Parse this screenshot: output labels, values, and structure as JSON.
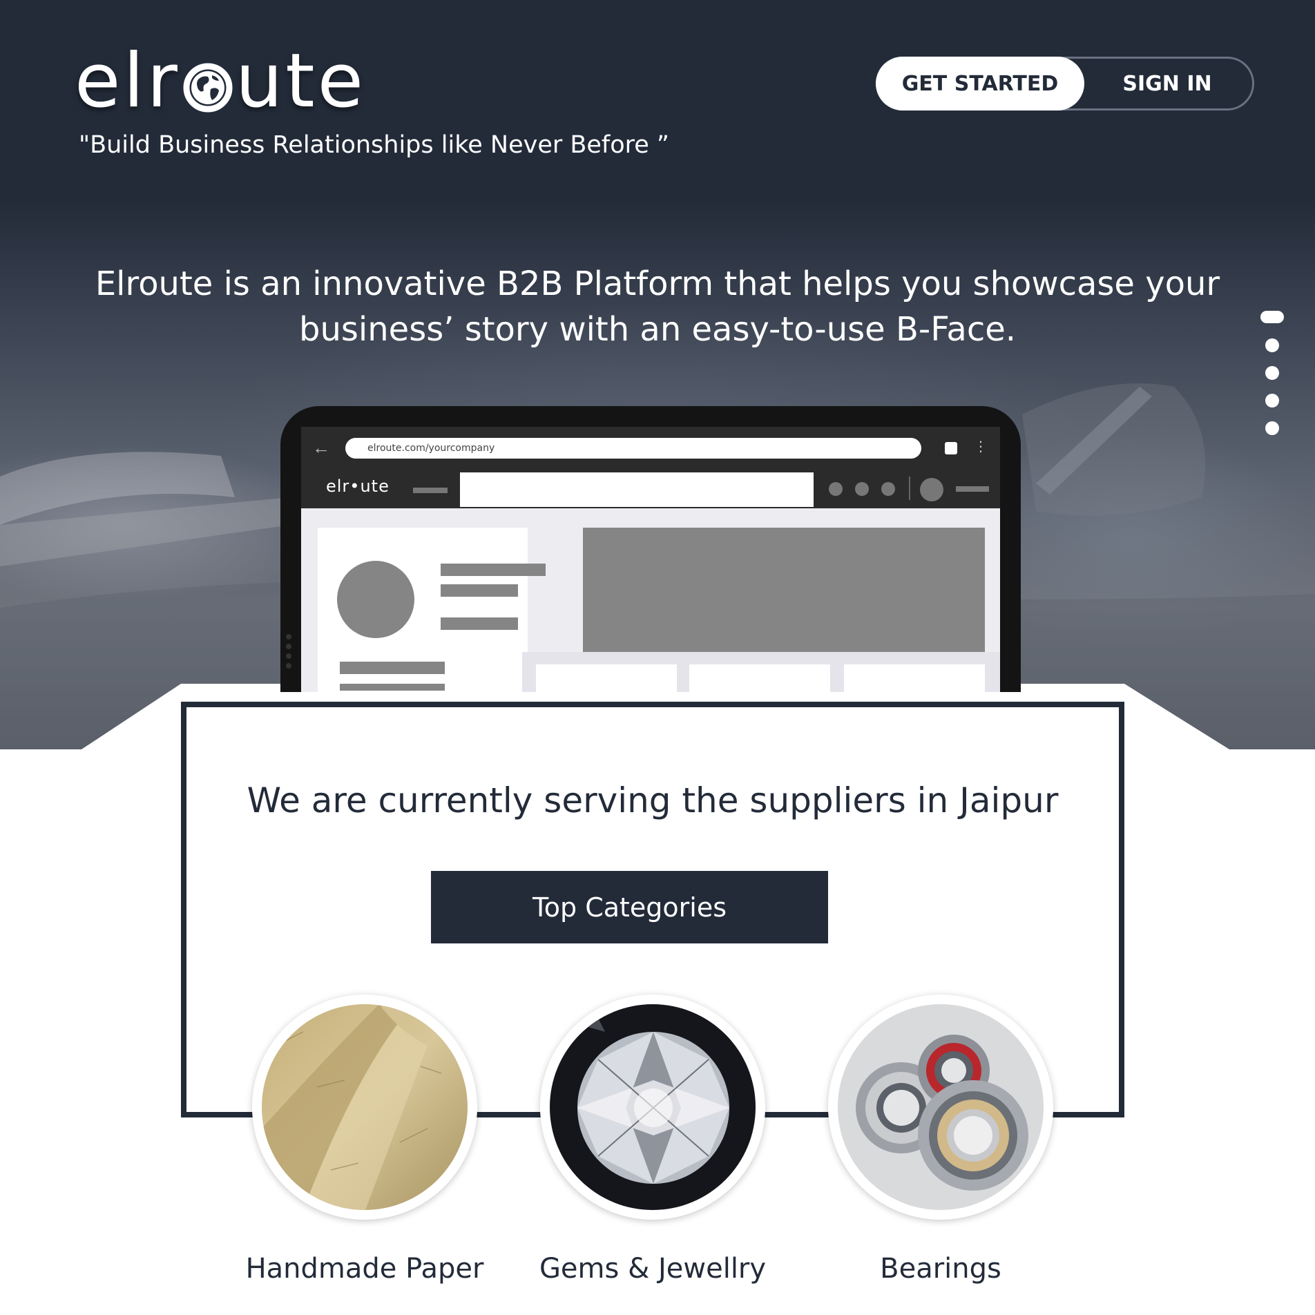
{
  "brand": {
    "logo_text_before": "elr",
    "logo_text_after": "ute",
    "tagline": "\"Build Business Relationships like Never Before ”"
  },
  "nav": {
    "get_started_label": "GET STARTED",
    "sign_in_label": "SIGN IN"
  },
  "hero": {
    "headline_line1": "Elroute is an innovative B2B Platform that helps you showcase your",
    "headline_line2": "business’ story with an easy-to-use B-Face.",
    "slide_count": 5,
    "active_slide": 1
  },
  "mockup": {
    "url": "elroute.com/yourcompany",
    "app_logo": "elr•ute"
  },
  "serving": {
    "text": "We are currently serving the suppliers in Jaipur",
    "top_categories_label": "Top Categories"
  },
  "categories": [
    {
      "label": "Handmade Paper"
    },
    {
      "label": "Gems & Jewellry"
    },
    {
      "label": "Bearings"
    }
  ],
  "colors": {
    "brand_navy": "#232b39",
    "white": "#ffffff"
  },
  "icons": [
    "globe-icon",
    "back-arrow-icon",
    "kebab-menu-icon"
  ]
}
